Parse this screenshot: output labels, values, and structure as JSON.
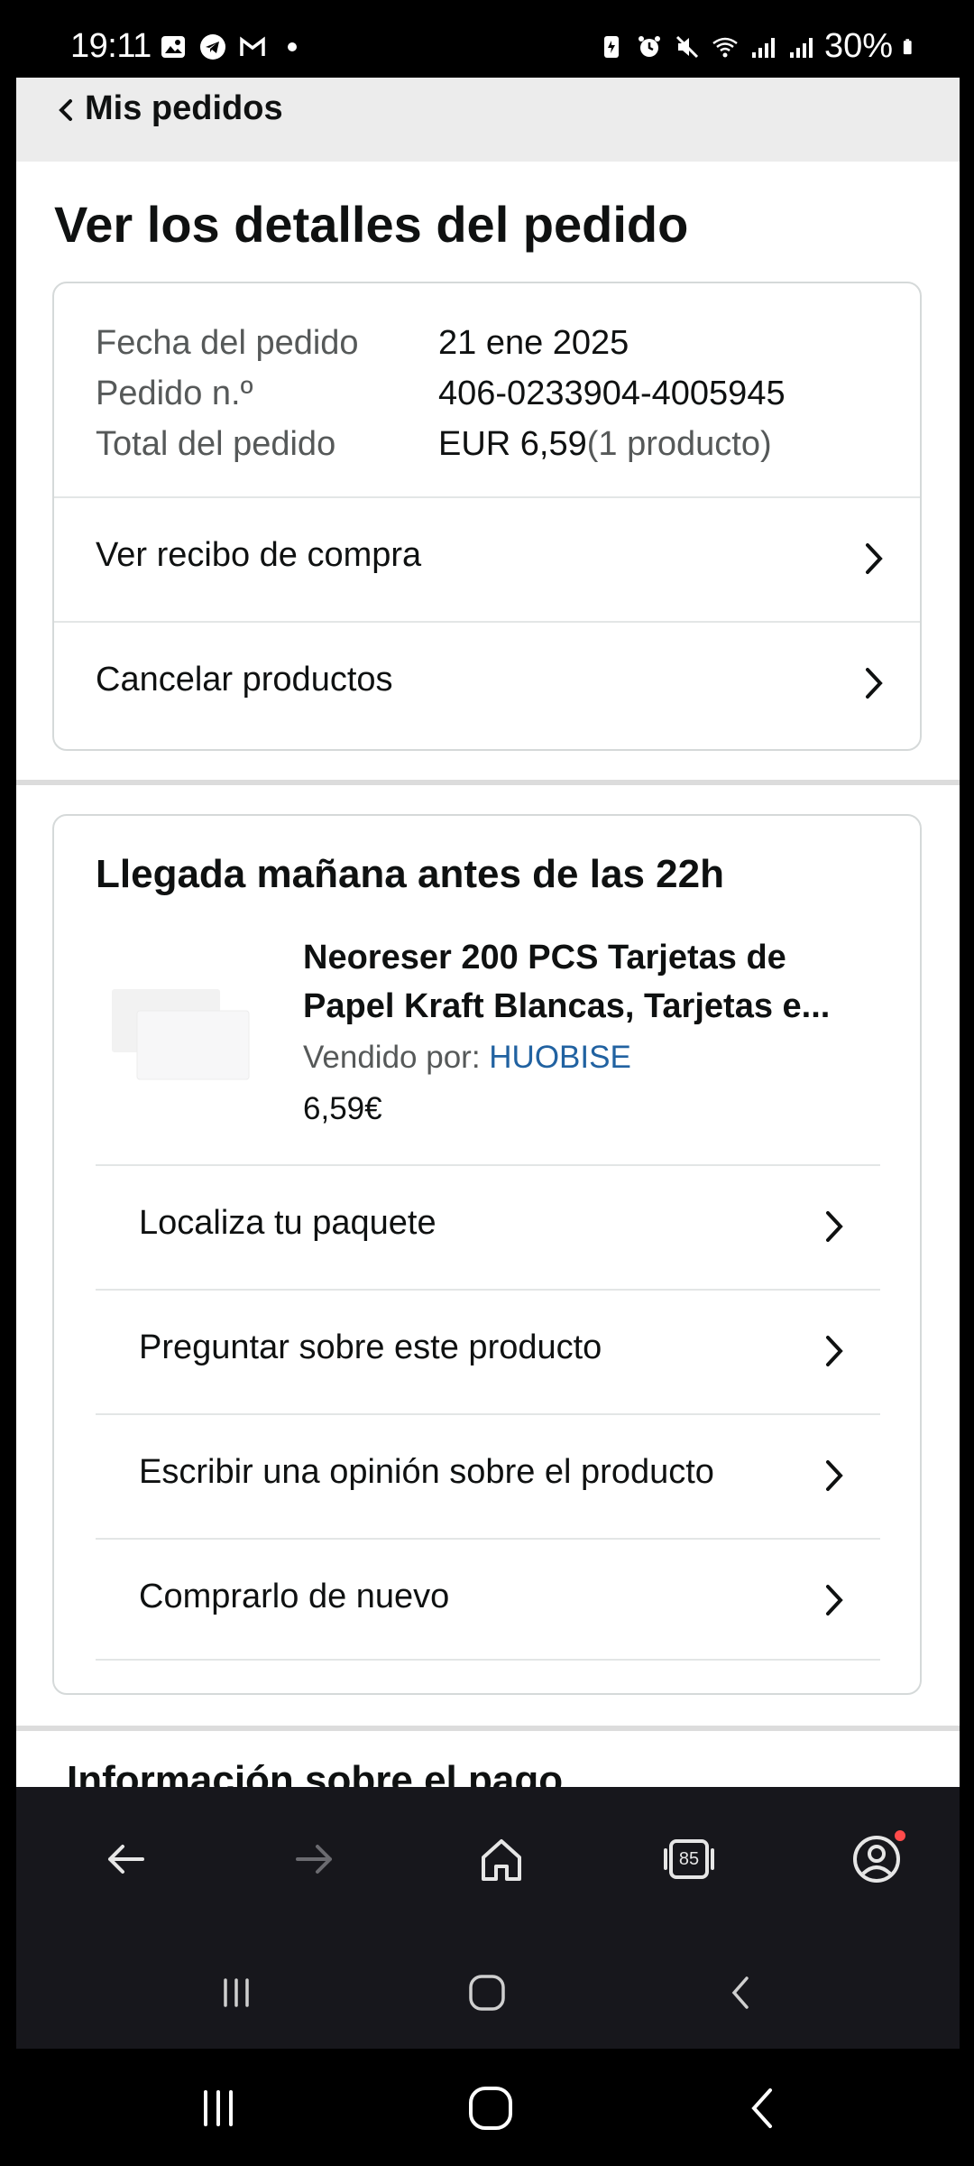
{
  "status_bar": {
    "time": "19:11",
    "battery": "30%"
  },
  "nav": {
    "back_label": "Mis pedidos"
  },
  "page": {
    "title": "Ver los detalles del pedido"
  },
  "order_summary": {
    "rows": [
      {
        "label": "Fecha del pedido",
        "value": "21 ene 2025",
        "extra": ""
      },
      {
        "label": "Pedido n.º",
        "value": "406-0233904-4005945",
        "extra": ""
      },
      {
        "label": "Total del pedido",
        "value": "EUR 6,59",
        "extra": " (1 producto)"
      }
    ],
    "links": [
      "Ver recibo de compra",
      "Cancelar productos"
    ]
  },
  "delivery": {
    "heading": "Llegada mañana antes de las 22h",
    "product": {
      "title": "Neoreser 200 PCS Tarjetas de Papel Kraft Blancas, Tarjetas e...",
      "seller_label": "Vendido por: ",
      "seller_name": "HUOBISE",
      "price": "6,59€"
    },
    "actions": [
      "Localiza tu paquete",
      "Preguntar sobre este producto",
      "Escribir una opinión sobre el producto",
      "Comprarlo de nuevo"
    ]
  },
  "next_section": {
    "title": "Información sobre el pago"
  },
  "browser_toolbar": {
    "tab_count": "85"
  },
  "colors": {
    "link_blue": "#2162a1",
    "toolbar_bg": "#17171c",
    "notification": "#ff4b4b"
  }
}
